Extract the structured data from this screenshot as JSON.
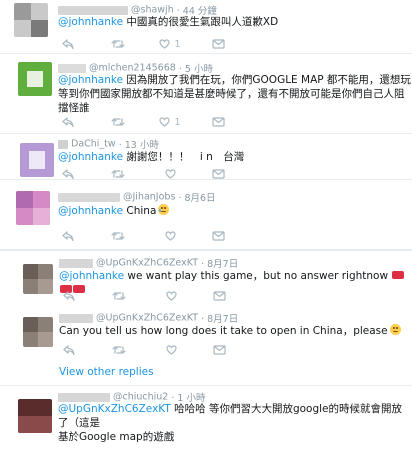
{
  "replies": [
    {
      "handle": "@shawjh",
      "time": "· 44 分鐘",
      "mention": "@johnhanke",
      "text": " 中國真的很愛生氣跟叫人道歉XD",
      "lines": [],
      "likes": "1"
    },
    {
      "handle": "@mlchen2145668",
      "time": "· 5 小時",
      "mention": "@johnhanke",
      "text": " 因為開放了我們在玩，你們GOOGLE MAP 都不能用，還想玩",
      "lines": [
        "等到你們國家開放都不知道是甚麼時候了，還有不開放可能是你們自己人阻擋怪誰"
      ],
      "likes": "1"
    },
    {
      "handle": "DaChi_tw",
      "time": "· 13 小時",
      "mention": "@johnhanke",
      "text": " 謝謝您！！！　i n　台灣",
      "lines": [],
      "likes": ""
    },
    {
      "handle": "@JihanJobs",
      "time": "· 8月6日",
      "mention": "@johnhanke",
      "text": " China",
      "lines": [],
      "likes": ""
    },
    {
      "handle": "@UpGnKxZhC6ZexKT",
      "time": "· 8月7日",
      "mention": "@johnhanke",
      "text": " we want play this game，but no answer rightnow",
      "lines": [],
      "likes": ""
    },
    {
      "handle": "@UpGnKxZhC6ZexKT",
      "time": "· 8月7日",
      "mention": "",
      "text": "Can you tell us how long does it take to open in China，please",
      "lines": [],
      "likes": ""
    },
    {
      "handle": "@chiuchiu2",
      "time": "· 1 小時",
      "mention": "@UpGnKxZhC6ZexKT",
      "text": " 哈哈哈 等你們習大大開放google的時候就會開放了（這是",
      "lines": [
        "基於Google map的遊戲"
      ],
      "likes": ""
    }
  ],
  "view_replies": "View other replies",
  "icons": [
    "reply-icon",
    "retweet-icon",
    "like-icon",
    "message-icon"
  ],
  "colors": {
    "link": "#1b95e0",
    "meta": "#8899a6",
    "icon": "#aab8c2",
    "border": "#e6ecf0"
  }
}
